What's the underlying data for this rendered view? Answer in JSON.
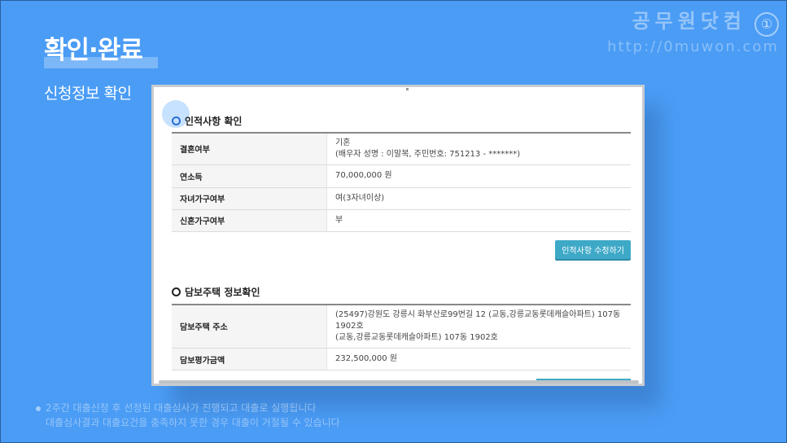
{
  "slide": {
    "title": "확인·완료",
    "subtitle": "신청정보 확인"
  },
  "watermark": {
    "logo": "공무원닷컴",
    "badge": "①",
    "url": "http://0muwon.com"
  },
  "personal": {
    "heading": "인적사항 확인",
    "rows": [
      {
        "label": "결혼여부",
        "value": "기혼",
        "value2": "(배우자 성명 : 이말복, 주민번호: 751213 - *******)"
      },
      {
        "label": "연소득",
        "value": "70,000,000 원"
      },
      {
        "label": "자녀가구여부",
        "value": "여(3자녀이상)"
      },
      {
        "label": "신혼가구여부",
        "value": "부"
      }
    ],
    "edit_button": "인적사항 수정하기"
  },
  "collateral": {
    "heading": "담보주택 정보확인",
    "rows": [
      {
        "label": "담보주택 주소",
        "value": "(25497)강원도 강릉시 화부산로99번길 12 (교동,강릉교동롯데캐슬아파트) 107동",
        "value2": "1902호",
        "value3": "(교동,강릉교동롯데캐슬아파트) 107동 1902호"
      },
      {
        "label": "담보평가금액",
        "value": "232,500,000 원"
      }
    ]
  },
  "caption": {
    "line1": "2주간 대출신청 후 선정된 대출심사가 진행되고 대출로 실행됩니다",
    "line2": "대출심사결과 대출요건을 충족하지 못한 경우 대출이 거절될 수 있습니다"
  },
  "colors": {
    "background": "#4a9cf5",
    "button": "#3ea9c7",
    "highlight": "#82beff"
  }
}
